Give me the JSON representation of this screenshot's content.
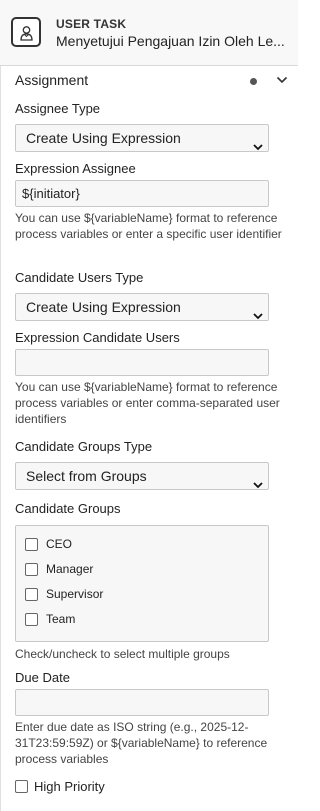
{
  "header": {
    "type_label": "USER TASK",
    "task_name": "Menyetujui Pengajuan Izin Oleh Le..."
  },
  "group": {
    "title": "Assignment"
  },
  "assignee_type": {
    "label": "Assignee Type",
    "selected": "Create Using Expression"
  },
  "expression_assignee": {
    "label": "Expression Assignee",
    "value": "${initiator}",
    "help": "You can use ${variableName} format to reference process variables or enter a specific user identifier"
  },
  "candidate_users_type": {
    "label": "Candidate Users Type",
    "selected": "Create Using Expression"
  },
  "expression_candidate_users": {
    "label": "Expression Candidate Users",
    "value": "",
    "help": "You can use ${variableName} format to reference process variables or enter comma-separated user identifiers"
  },
  "candidate_groups_type": {
    "label": "Candidate Groups Type",
    "selected": "Select from Groups"
  },
  "candidate_groups": {
    "label": "Candidate Groups",
    "options": [
      {
        "label": "CEO",
        "checked": false
      },
      {
        "label": "Manager",
        "checked": false
      },
      {
        "label": "Supervisor",
        "checked": false
      },
      {
        "label": "Team",
        "checked": false
      }
    ],
    "help": "Check/uncheck to select multiple groups"
  },
  "due_date": {
    "label": "Due Date",
    "value": "",
    "help": "Enter due date as ISO string (e.g., 2025-12-31T23:59:59Z) or ${variableName} to reference process variables"
  },
  "high_priority": {
    "label": "High Priority",
    "checked": false
  }
}
